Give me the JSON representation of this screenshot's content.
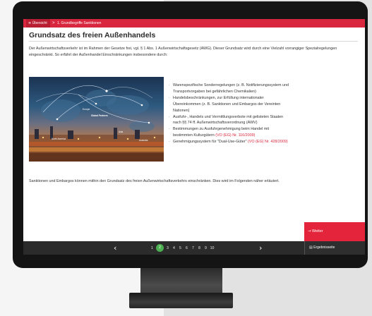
{
  "breadcrumb": {
    "overview_icon": "menu-icon",
    "overview": "Übersicht",
    "separator": ">",
    "current": "1. Grundbegriffe Sanktionen"
  },
  "page": {
    "title": "Grundsatz des freien Außenhandels",
    "intro": "Der Außenwirtschaftsverkehr ist im Rahmen der Gesetze frei, vgl. § 1 Abs. 1 Außenwirtschaftsgesetz (AWG). Dieser Grundsatz wird durch eine Vielzahl vorrangiger Spezialregelungen eingeschränkt. So erfährt der Außenhandel Einschränkungen insbesondere durch:",
    "bullets": [
      {
        "text": "Warenspezifische Sonderregelungen (z. B. Notifizierungssystem und Transportvorgaben bei gefährlichen Chemikalien)",
        "ref": ""
      },
      {
        "text": "Handelsbeschränkungen, zur Erfüllung internationaler Übereinkommen (z. B. Sanktionen und Embargos der Vereinten Nationen)",
        "ref": ""
      },
      {
        "text": "Ausfuhr-, Handels und Vermittlungsverbote mit gelisteten Staaten nach §§ 74 ff. Außenwirtschaftsverordnung (AWV)",
        "ref": ""
      },
      {
        "text": "Bestimmungen zu Ausfuhrgenehmigung beim Handel mit bestimmten Kulturgütern ",
        "ref": "(VO (EG) Nr. 116/2009)"
      },
      {
        "text": "Genehmigungssystem für \"Dual-Use-Güter\" ",
        "ref": "(VO (EG) Nr. 428/2009)"
      }
    ],
    "conclusion": "Sanktionen und Embargos können mithin den Grundsatz des freien Außenwirtschaftsverkehrs einschränken. Dies wird im Folgenden näher erläutert."
  },
  "image": {
    "labels": [
      "Europe",
      "Global Partners",
      "North America",
      "Asia",
      "Australia"
    ]
  },
  "buttons": {
    "weiter_icon": "arrow-right-icon",
    "weiter": "Weiter",
    "results_icon": "document-icon",
    "results": "Ergebnisseite"
  },
  "pagination": {
    "prev": "‹",
    "next": "›",
    "pages": [
      "1",
      "2",
      "3",
      "4",
      "5",
      "6",
      "7",
      "8",
      "9",
      "10"
    ],
    "current": "2"
  },
  "colors": {
    "accent": "#d7263d",
    "active_page": "#4caf50",
    "navbar": "#2b2b2b"
  }
}
